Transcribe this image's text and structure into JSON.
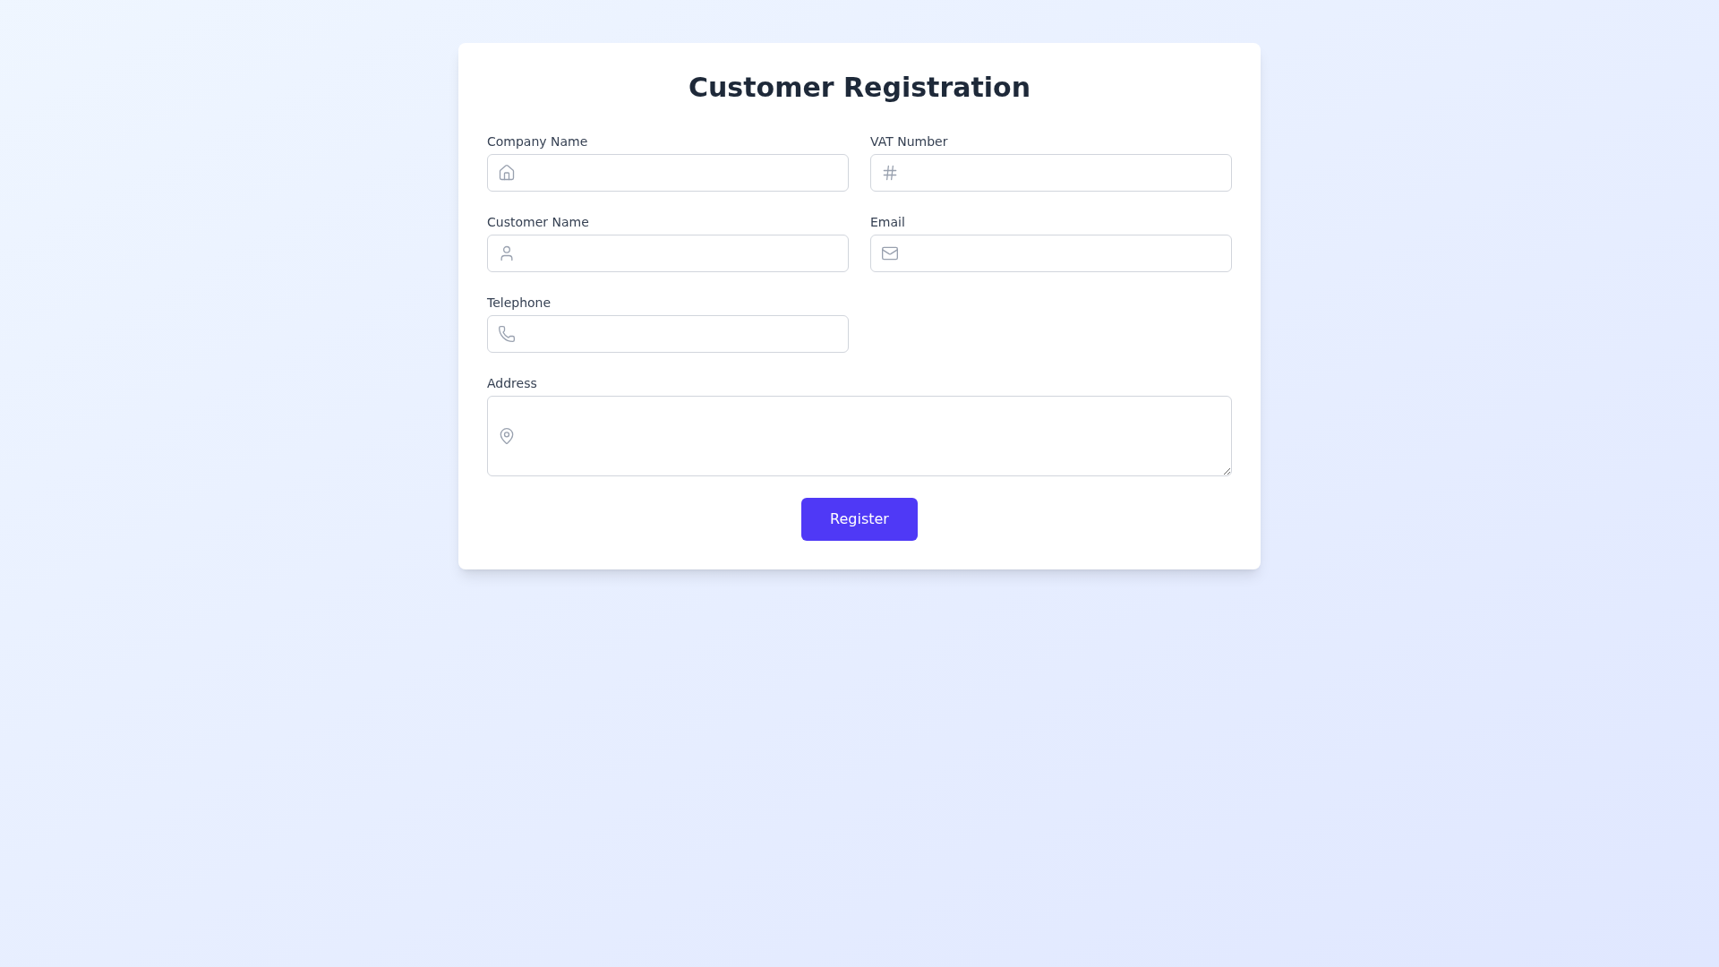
{
  "title": "Customer Registration",
  "fields": [
    {
      "label": "Company Name",
      "kind": "input"
    },
    {
      "label": "VAT Number",
      "kind": "input"
    },
    {
      "label": "Customer Name",
      "kind": "input"
    },
    {
      "label": "Email",
      "kind": "input"
    },
    {
      "label": "Telephone",
      "kind": "input"
    },
    {
      "label": "Address",
      "kind": "textarea"
    }
  ],
  "button": {
    "label": "Register"
  }
}
